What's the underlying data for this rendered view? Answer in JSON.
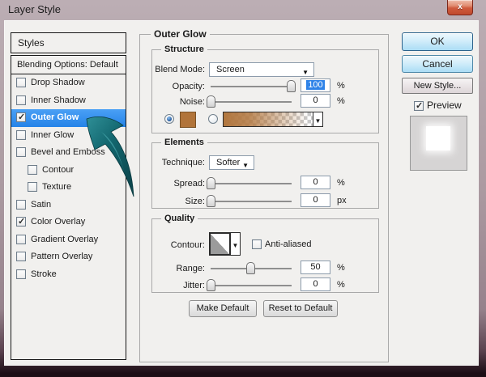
{
  "window": {
    "title": "Layer Style",
    "close_glyph": "x"
  },
  "sidebar": {
    "header": "Styles",
    "blending_row": "Blending Options: Default",
    "items": [
      {
        "label": "Drop Shadow",
        "checked": false,
        "selected": false,
        "indent": false
      },
      {
        "label": "Inner Shadow",
        "checked": false,
        "selected": false,
        "indent": false
      },
      {
        "label": "Outer Glow",
        "checked": true,
        "selected": true,
        "indent": false
      },
      {
        "label": "Inner Glow",
        "checked": false,
        "selected": false,
        "indent": false
      },
      {
        "label": "Bevel and Emboss",
        "checked": false,
        "selected": false,
        "indent": false
      },
      {
        "label": "Contour",
        "checked": false,
        "selected": false,
        "indent": true
      },
      {
        "label": "Texture",
        "checked": false,
        "selected": false,
        "indent": true
      },
      {
        "label": "Satin",
        "checked": false,
        "selected": false,
        "indent": false
      },
      {
        "label": "Color Overlay",
        "checked": true,
        "selected": false,
        "indent": false
      },
      {
        "label": "Gradient Overlay",
        "checked": false,
        "selected": false,
        "indent": false
      },
      {
        "label": "Pattern Overlay",
        "checked": false,
        "selected": false,
        "indent": false
      },
      {
        "label": "Stroke",
        "checked": false,
        "selected": false,
        "indent": false
      }
    ]
  },
  "panel": {
    "title": "Outer Glow",
    "structure": {
      "legend": "Structure",
      "blend_mode_label": "Blend Mode:",
      "blend_mode_value": "Screen",
      "opacity_label": "Opacity:",
      "opacity_value": "100",
      "opacity_unit": "%",
      "noise_label": "Noise:",
      "noise_value": "0",
      "noise_unit": "%",
      "glow_color_hex": "#b1743a",
      "color_selected": true,
      "gradient_selected": false
    },
    "elements": {
      "legend": "Elements",
      "technique_label": "Technique:",
      "technique_value": "Softer",
      "spread_label": "Spread:",
      "spread_value": "0",
      "spread_unit": "%",
      "size_label": "Size:",
      "size_value": "0",
      "size_unit": "px"
    },
    "quality": {
      "legend": "Quality",
      "contour_label": "Contour:",
      "antialiased_label": "Anti-aliased",
      "antialiased_checked": false,
      "range_label": "Range:",
      "range_value": "50",
      "range_unit": "%",
      "jitter_label": "Jitter:",
      "jitter_value": "0",
      "jitter_unit": "%"
    },
    "make_default_label": "Make Default",
    "reset_default_label": "Reset to Default"
  },
  "actions": {
    "ok_label": "OK",
    "cancel_label": "Cancel",
    "new_style_label": "New Style...",
    "preview_label": "Preview",
    "preview_checked": true
  },
  "sliders": {
    "opacity": 100,
    "noise": 0,
    "spread": 0,
    "size": 0,
    "range": 50,
    "jitter": 0
  },
  "colors": {
    "selection_blue": "#2e8ceb",
    "glow_brown": "#b1743a",
    "arrow_teal": "#156067",
    "dialog_bg": "#f1f0ee"
  }
}
